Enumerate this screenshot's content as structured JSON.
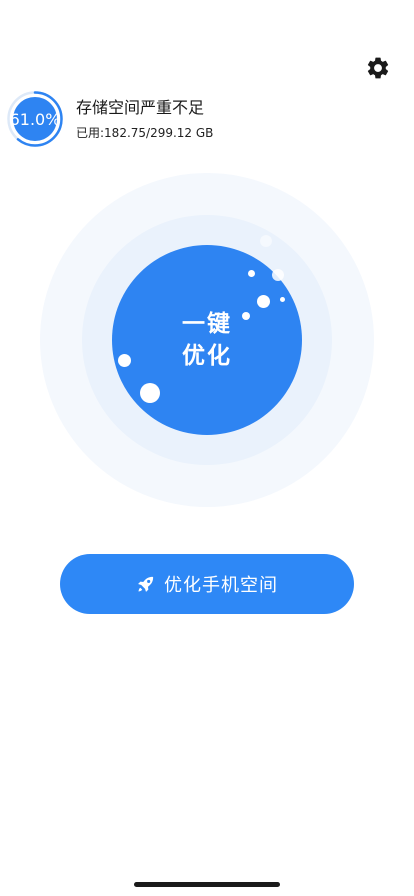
{
  "storage": {
    "percent_label": "61.0%",
    "usage_fraction": 0.61,
    "title": "存储空间严重不足",
    "used_label": "已用:182.75/299.12 GB"
  },
  "orb": {
    "line1": "一键",
    "line2": "优化"
  },
  "primary_button": {
    "label": "优化手机空间",
    "icon": "rocket-icon"
  },
  "header": {
    "settings_icon": "gear-icon"
  },
  "colors": {
    "accent": "#2e84f2",
    "button": "#2e88f6",
    "ring_outer": "#f4f8fd",
    "ring_mid": "#eaf2fc"
  }
}
